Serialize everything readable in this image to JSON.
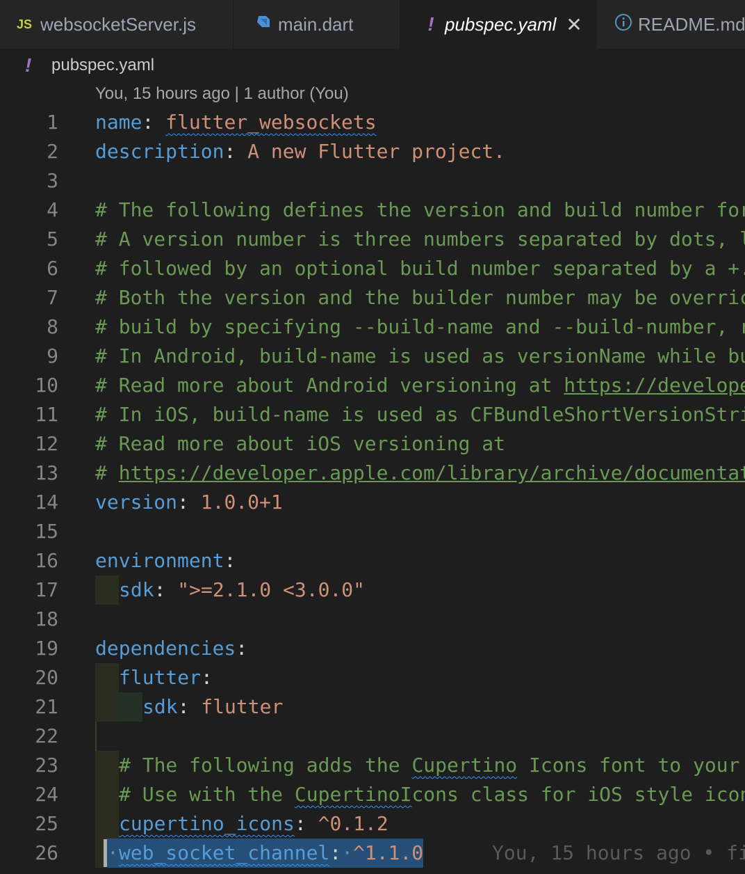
{
  "tabs": [
    {
      "icon": "js-icon",
      "label": "websocketServer.js"
    },
    {
      "icon": "dart-icon",
      "label": "main.dart"
    },
    {
      "icon": "yaml-icon",
      "label": "pubspec.yaml"
    },
    {
      "icon": "info-icon",
      "label": "README.md"
    }
  ],
  "breadcrumb": {
    "file": "pubspec.yaml"
  },
  "codelens": "You, 15 hours ago | 1 author (You)",
  "lines": [
    {
      "n": "1"
    },
    {
      "n": "2"
    },
    {
      "n": "3"
    },
    {
      "n": "4"
    },
    {
      "n": "5"
    },
    {
      "n": "6"
    },
    {
      "n": "7"
    },
    {
      "n": "8"
    },
    {
      "n": "9"
    },
    {
      "n": "10"
    },
    {
      "n": "11"
    },
    {
      "n": "12"
    },
    {
      "n": "13"
    },
    {
      "n": "14"
    },
    {
      "n": "15"
    },
    {
      "n": "16"
    },
    {
      "n": "17"
    },
    {
      "n": "18"
    },
    {
      "n": "19"
    },
    {
      "n": "20"
    },
    {
      "n": "21"
    },
    {
      "n": "22"
    },
    {
      "n": "23"
    },
    {
      "n": "24"
    },
    {
      "n": "25"
    },
    {
      "n": "26"
    }
  ],
  "code": {
    "l1": {
      "key": "name",
      "value": "flutter_websockets"
    },
    "l2": {
      "key": "description",
      "value": "A new Flutter project."
    },
    "l4": "# The following defines the version and build number for",
    "l5": "# A version number is three numbers separated by dots, l",
    "l6": "# followed by an optional build number separated by a +.",
    "l7": "# Both the version and the builder number may be overric",
    "l8": "# build by specifying --build-name and --build-number, r",
    "l9": "# In Android, build-name is used as versionName while bu",
    "l10": {
      "text": "# Read more about Android versioning at ",
      "link": "https://develope"
    },
    "l11": "# In iOS, build-name is used as CFBundleShortVersionStri",
    "l12": "# Read more about iOS versioning at",
    "l13": {
      "text": "# ",
      "link": "https://developer.apple.com/library/archive/documentat"
    },
    "l14": {
      "key": "version",
      "value": "1.0.0+1"
    },
    "l16": {
      "key": "environment"
    },
    "l17": {
      "key": "sdk",
      "value": "\">=2.1.0 <3.0.0\""
    },
    "l19": {
      "key": "dependencies"
    },
    "l20": {
      "key": "flutter"
    },
    "l21": {
      "key": "sdk",
      "value": "flutter"
    },
    "l23": {
      "pre": "# The following adds the ",
      "sq": "Cupertino",
      "post": " Icons font to your"
    },
    "l24": {
      "pre": "# Use with the ",
      "sq": "CupertinoI",
      "post": "cons class for iOS style icon"
    },
    "l25": {
      "key": "cupertino_icons",
      "value": "^0.1.2"
    },
    "l26": {
      "key": "web_socket_channel",
      "value": "^1.1.0",
      "blame": "You, 15 hours ago • fi"
    }
  }
}
